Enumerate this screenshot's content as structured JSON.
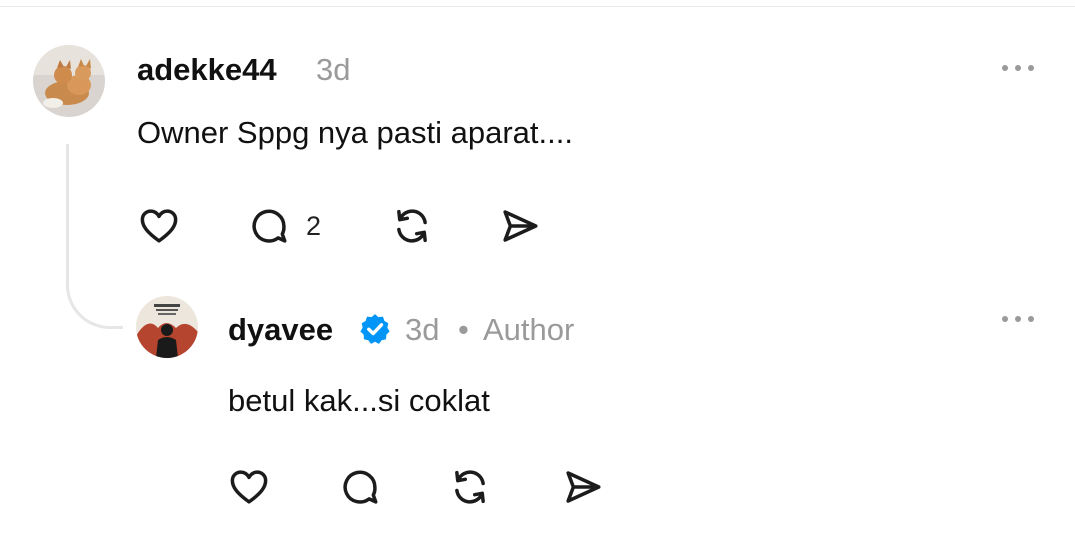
{
  "comment": {
    "username": "adekke44",
    "time": "3d",
    "text": "Owner Sppg nya pasti aparat....",
    "reply_count": "2",
    "avatar": "cat-photo-avatar"
  },
  "reply": {
    "username": "dyavee",
    "time": "3d",
    "separator": "•",
    "role": "Author",
    "text": "betul kak...si coklat",
    "verified": true,
    "avatar": "poster-avatar"
  },
  "icons": [
    "more-icon",
    "heart-icon",
    "comment-icon",
    "repost-icon",
    "share-icon",
    "verified-icon"
  ],
  "colors": {
    "verified_blue": "#0095f6",
    "meta_gray": "#9a9a9a",
    "icon_dark": "#1c1c1c"
  }
}
